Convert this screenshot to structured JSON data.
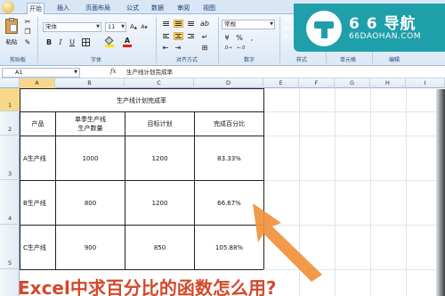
{
  "ribbon": {
    "tabs": [
      "开始",
      "插入",
      "页面布局",
      "公式",
      "数据",
      "审阅",
      "视图"
    ],
    "active_tab": "开始",
    "clipboard": {
      "paste_label": "粘贴",
      "group_label": "剪贴板"
    },
    "font": {
      "name": "宋体",
      "size": "11",
      "group_label": "字体"
    },
    "alignment": {
      "group_label": "对齐方式"
    },
    "number": {
      "format": "常规",
      "group_label": "数字"
    },
    "styles": {
      "items": [
        "条件",
        "套用",
        "单元"
      ],
      "group_label": "样式"
    },
    "cells": {
      "group_label": "单元格"
    },
    "editing": {
      "group_label": "编辑"
    }
  },
  "watermark": {
    "brand": "6 6 导航",
    "url": "66DAOHAN.COM"
  },
  "formula_bar": {
    "name_box": "A1",
    "fx": "fx",
    "content": "生产线计划完成率"
  },
  "sheet": {
    "columns": [
      "A",
      "B",
      "C",
      "D",
      "E",
      "F",
      "G",
      "H",
      "I"
    ],
    "rows": [
      "1",
      "2",
      "3",
      "4",
      "5"
    ],
    "title": "生产线计划完成率",
    "headers": [
      "产品",
      "单季生产线\n生产数量",
      "目标计划",
      "完成百分比"
    ],
    "data": [
      {
        "product": "A生产线",
        "qty": "1000",
        "target": "1200",
        "pct": "83.33%"
      },
      {
        "product": "B生产线",
        "qty": "800",
        "target": "1200",
        "pct": "66.67%"
      },
      {
        "product": "C生产线",
        "qty": "900",
        "target": "850",
        "pct": "105.88%"
      }
    ]
  },
  "caption": "Excel中求百分比的函数怎么用?"
}
